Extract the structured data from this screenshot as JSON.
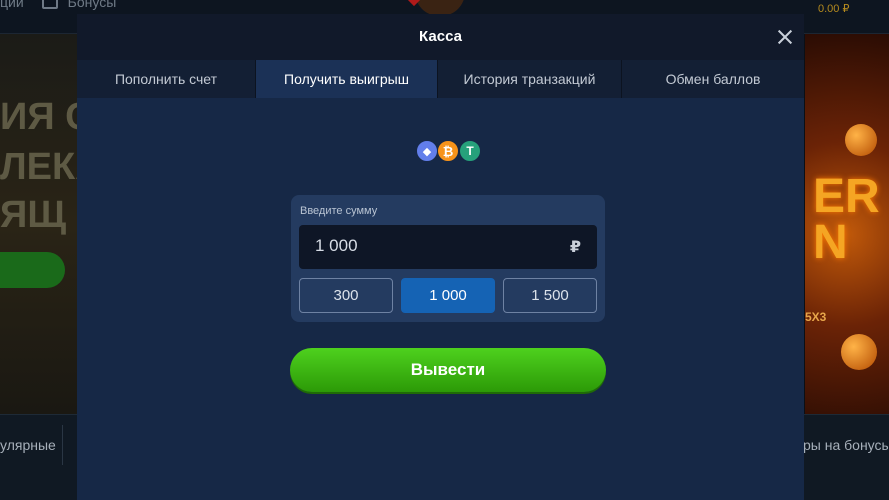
{
  "background": {
    "nav_left_text": "ции",
    "nav_bonus_label": "Бонусы",
    "balance": "0.00 ₽",
    "promo_lines": [
      "ИЯ СО",
      "ЛЕКА",
      "ЯЩ"
    ],
    "promo_right_big": "ER\nN",
    "promo_right_tag": "5X3",
    "bottom_left_label": "улярные",
    "bottom_right_label": "ры на бонусы"
  },
  "modal": {
    "title": "Касса",
    "tabs": [
      {
        "label": "Пополнить счет",
        "active": false
      },
      {
        "label": "Получить выигрыш",
        "active": true
      },
      {
        "label": "История транзакций",
        "active": false
      },
      {
        "label": "Обмен баллов",
        "active": false
      }
    ],
    "crypto_icons": [
      {
        "name": "ethereum-icon",
        "glyph": "◆"
      },
      {
        "name": "bitcoin-icon",
        "glyph": "₿"
      },
      {
        "name": "tether-icon",
        "glyph": "T"
      }
    ],
    "amount": {
      "label": "Введите сумму",
      "value": "1 000",
      "currency_symbol": "₽",
      "presets": [
        "300",
        "1 000",
        "1 500"
      ],
      "selected_preset": "1 000"
    },
    "withdraw_button": "Вывести"
  },
  "colors": {
    "modal_bg": "#162846",
    "header_bg": "#11192a",
    "active_tab": "#1b3156",
    "selected_preset": "#1563b4",
    "withdraw_green": "#3bb512"
  }
}
